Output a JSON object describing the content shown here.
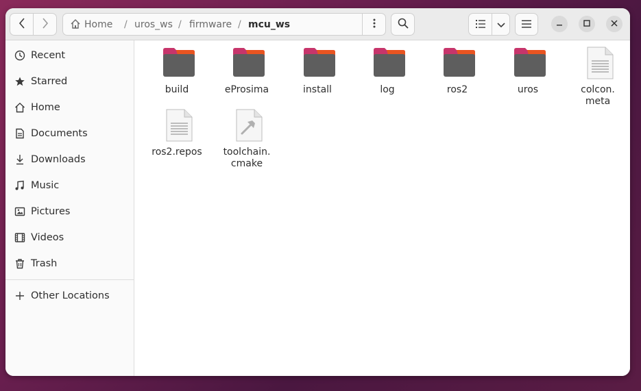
{
  "headerbar": {
    "breadcrumb": [
      "Home",
      "uros_ws",
      "firmware",
      "mcu_ws"
    ],
    "separator": "/"
  },
  "sidebar": {
    "items": [
      {
        "label": "Recent",
        "icon": "clock-icon"
      },
      {
        "label": "Starred",
        "icon": "star-icon"
      },
      {
        "label": "Home",
        "icon": "home-icon"
      },
      {
        "label": "Documents",
        "icon": "document-icon"
      },
      {
        "label": "Downloads",
        "icon": "download-icon"
      },
      {
        "label": "Music",
        "icon": "music-icon"
      },
      {
        "label": "Pictures",
        "icon": "picture-icon"
      },
      {
        "label": "Videos",
        "icon": "video-icon"
      },
      {
        "label": "Trash",
        "icon": "trash-icon"
      }
    ],
    "other_locations": "Other Locations"
  },
  "files": [
    {
      "name": "build",
      "type": "folder"
    },
    {
      "name": "eProsima",
      "type": "folder"
    },
    {
      "name": "install",
      "type": "folder"
    },
    {
      "name": "log",
      "type": "folder"
    },
    {
      "name": "ros2",
      "type": "folder"
    },
    {
      "name": "uros",
      "type": "folder"
    },
    {
      "name": "colcon.\nmeta",
      "type": "text"
    },
    {
      "name": "ros2.repos",
      "type": "text"
    },
    {
      "name": "toolchain.\ncmake",
      "type": "cmake"
    }
  ],
  "colors": {
    "folder_tab": "#c7356b",
    "folder_tab_accent": "#e95420",
    "folder_body": "#5e5e5e",
    "window_bg": "#ffffff",
    "headerbar_bg": "#ebebeb"
  }
}
